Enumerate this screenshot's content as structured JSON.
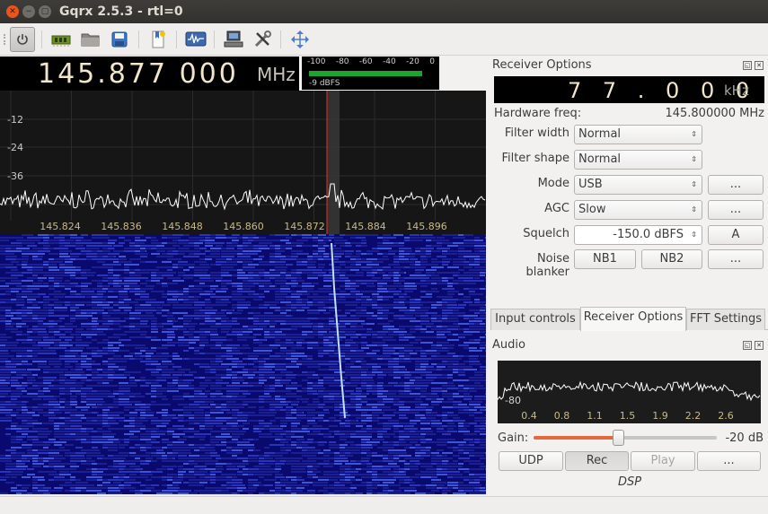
{
  "window": {
    "title": "Gqrx 2.5.3 - rtl=0"
  },
  "toolbar": {
    "icons": [
      "power-icon",
      "hardware-icon",
      "folder-icon",
      "save-icon",
      "bookmark-icon",
      "fft-icon",
      "network-icon",
      "tools-icon",
      "fullscreen-icon"
    ]
  },
  "frequency": {
    "digits": "145.877 000",
    "unit": "MHz"
  },
  "meter": {
    "ticks": [
      "-100",
      "-80",
      "-60",
      "-40",
      "-20",
      "0"
    ],
    "level_label": "-9 dBFS",
    "level_dbfs": -9,
    "colors": {
      "bar": "#1aa52d"
    }
  },
  "plotter": {
    "y_ticks": [
      "-12",
      "-24",
      "-36"
    ],
    "x_ticks": [
      "145.824",
      "145.836",
      "145.848",
      "145.860",
      "145.872",
      "145.884",
      "145.896"
    ],
    "colors": {
      "trace": "#ffffff",
      "tick_label": "#c9b98a",
      "marker": "#e4322b"
    }
  },
  "waterfall": {
    "colors": {
      "background": "#0a0a6e",
      "signal": "#bfe0ff"
    }
  },
  "receiver": {
    "title": "Receiver Options",
    "offset_digits": "7 7 . 0 0 0",
    "offset_unit": "kHz",
    "hardware_freq_label": "Hardware freq:",
    "hardware_freq_value": "145.800000 MHz",
    "filter_width_label": "Filter width",
    "filter_width_value": "Normal",
    "filter_shape_label": "Filter shape",
    "filter_shape_value": "Normal",
    "mode_label": "Mode",
    "mode_value": "USB",
    "mode_more": "...",
    "agc_label": "AGC",
    "agc_value": "Slow",
    "agc_more": "...",
    "squelch_label": "Squelch",
    "squelch_value": "-150.0 dBFS",
    "squelch_auto": "A",
    "nb_label": "Noise blanker",
    "nb1": "NB1",
    "nb2": "NB2",
    "nb_more": "..."
  },
  "tabs": [
    {
      "label": "Input controls"
    },
    {
      "label": "Receiver Options"
    },
    {
      "label": "FFT Settings"
    }
  ],
  "audio": {
    "title": "Audio",
    "y_tick": "-80",
    "x_ticks": [
      "0.4",
      "0.8",
      "1.1",
      "1.5",
      "1.9",
      "2.2",
      "2.6"
    ],
    "gain_label": "Gain:",
    "gain_value": "-20 dB",
    "gain_level_fraction": 0.46,
    "udp": "UDP",
    "rec": "Rec",
    "play": "Play",
    "more": "...",
    "dsp_label": "DSP"
  }
}
